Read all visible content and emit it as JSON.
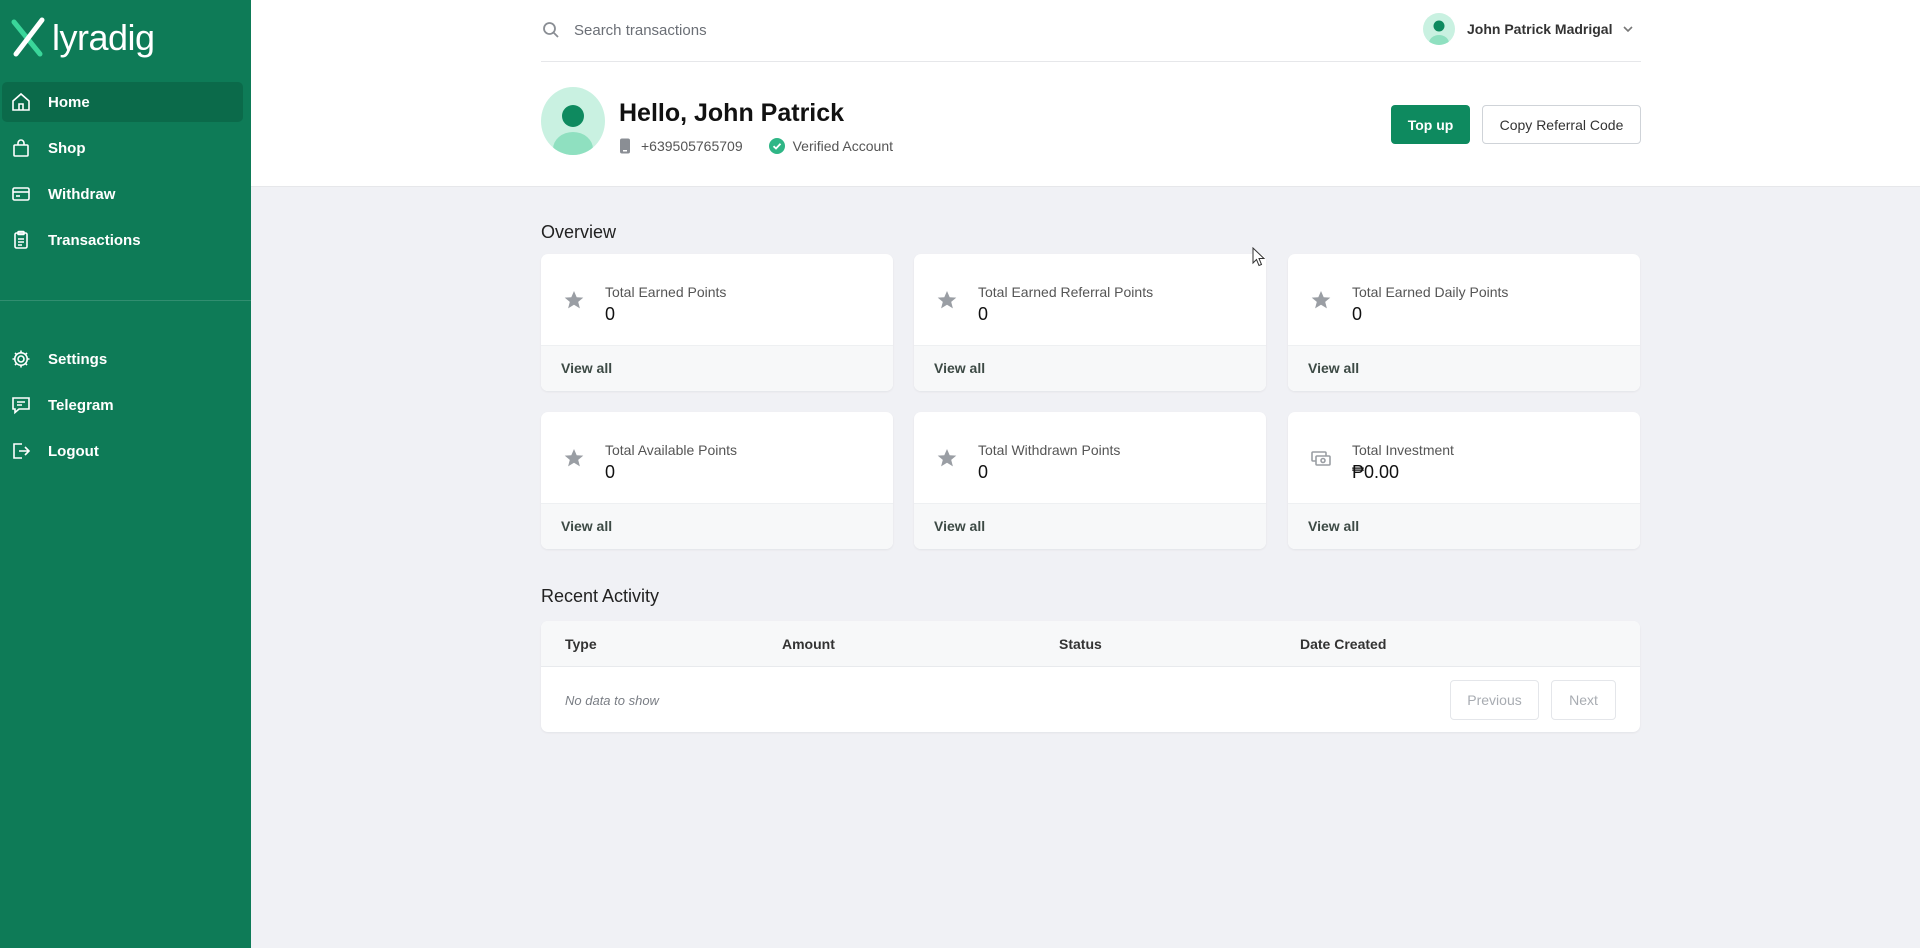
{
  "app": {
    "brand": "lyradig",
    "colors": {
      "sidebar": "#0e7b57",
      "primary": "#0e8a5f",
      "avatar_bg": "#c9f1e1"
    }
  },
  "sidebar": {
    "items": [
      {
        "label": "Home",
        "icon": "home-icon",
        "active": true
      },
      {
        "label": "Shop",
        "icon": "shopping-bag-icon"
      },
      {
        "label": "Withdraw",
        "icon": "wallet-card-icon"
      },
      {
        "label": "Transactions",
        "icon": "clipboard-icon"
      }
    ],
    "secondary": [
      {
        "label": "Settings",
        "icon": "gear-icon"
      },
      {
        "label": "Telegram",
        "icon": "chat-icon"
      },
      {
        "label": "Logout",
        "icon": "logout-icon"
      }
    ]
  },
  "header": {
    "search_placeholder": "Search transactions",
    "user_name": "John Patrick Madrigal"
  },
  "profile": {
    "greeting": "Hello, John Patrick",
    "phone": "+639505765709",
    "verified": "Verified Account",
    "topup_label": "Top up",
    "referral_label": "Copy Referral Code"
  },
  "overview": {
    "title": "Overview",
    "cards": [
      {
        "label": "Total Earned Points",
        "value": "0",
        "link": "View all",
        "icon": "star-icon"
      },
      {
        "label": "Total Earned Referral Points",
        "value": "0",
        "link": "View all",
        "icon": "star-icon"
      },
      {
        "label": "Total Earned Daily Points",
        "value": "0",
        "link": "View all",
        "icon": "star-icon"
      },
      {
        "label": "Total Available Points",
        "value": "0",
        "link": "View all",
        "icon": "star-icon"
      },
      {
        "label": "Total Withdrawn Points",
        "value": "0",
        "link": "View all",
        "icon": "star-icon"
      },
      {
        "label": "Total Investment",
        "value": "₱0.00",
        "link": "View all",
        "icon": "cash-icon"
      }
    ]
  },
  "activity": {
    "title": "Recent Activity",
    "columns": [
      "Type",
      "Amount",
      "Status",
      "Date Created"
    ],
    "empty": "No data to show",
    "prev_label": "Previous",
    "next_label": "Next"
  }
}
